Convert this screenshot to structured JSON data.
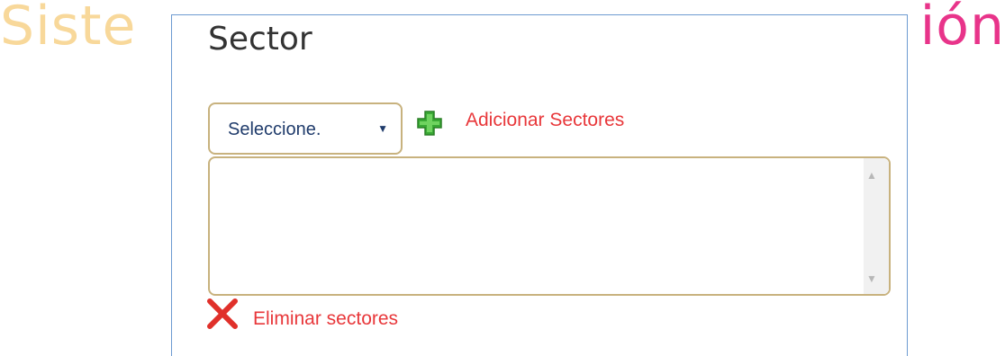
{
  "background": {
    "title_left": "Siste",
    "title_right": "ión"
  },
  "dialog": {
    "title": "Sector",
    "select": {
      "value": "Seleccione.",
      "arrow": "▼"
    },
    "add_link": "Adicionar Sectores",
    "list": {
      "items": []
    },
    "remove_link": "Eliminar sectores"
  },
  "colors": {
    "link": "#e8373a",
    "border": "#c8b27e",
    "dialog_border": "#6d9bd1",
    "add_icon": "#3aaa35",
    "remove_icon": "#e0302a"
  },
  "icons": {
    "add": "plus-icon",
    "remove": "x-icon"
  }
}
